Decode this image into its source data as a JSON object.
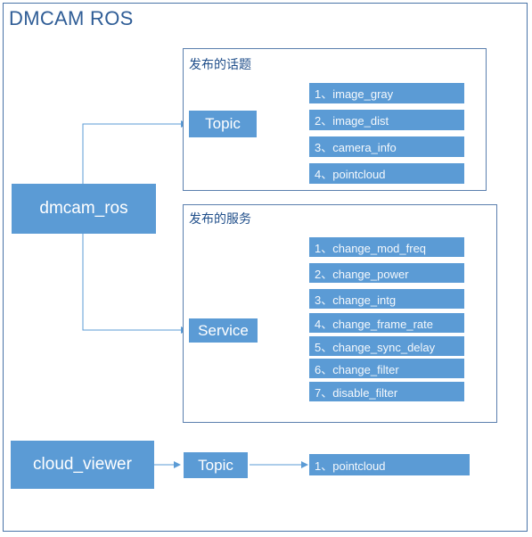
{
  "title": "DMCAM ROS",
  "colors": {
    "box": "#5b9bd5",
    "line": "#5b9bd5",
    "border": "#5b7fae",
    "title": "#2f5d96"
  },
  "nodes": {
    "dmcam_ros": "dmcam_ros",
    "cloud_viewer": "cloud_viewer"
  },
  "topics_group": {
    "label": "发布的话题",
    "hub": "Topic",
    "items": [
      "1、image_gray",
      "2、image_dist",
      "3、camera_info",
      "4、pointcloud"
    ]
  },
  "services_group": {
    "label": "发布的服务",
    "hub": "Service",
    "items": [
      "1、change_mod_freq",
      "2、change_power",
      "3、change_intg",
      "4、change_frame_rate",
      "5、change_sync_delay",
      "6、change_filter",
      "7、disable_filter"
    ]
  },
  "viewer_topic": {
    "hub": "Topic",
    "items": [
      "1、pointcloud"
    ]
  }
}
